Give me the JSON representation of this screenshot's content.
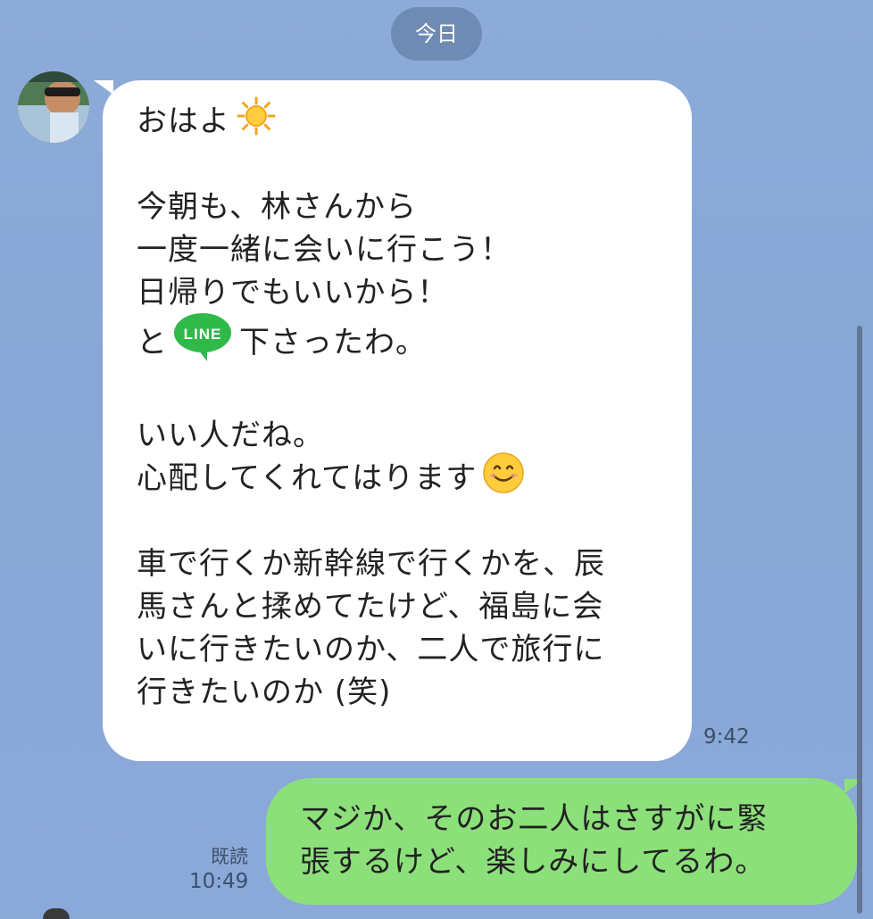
{
  "date_separator": "今日",
  "incoming": {
    "lines": {
      "l1": "おはよ",
      "l3": "今朝も、林さんから",
      "l4": "一度一緒に会いに行こう！",
      "l5": "日帰りでもいいから！",
      "l6a": "と",
      "l6b": "下さったわ。",
      "l8": "いい人だね。",
      "l9": "心配してくれてはります",
      "l11": "車で行くか新幹線で行くかを、辰",
      "l12": "馬さんと揉めてたけど、福島に会",
      "l13": "いに行きたいのか、二人で旅行に",
      "l14": "行きたいのか (笑)"
    },
    "emoji_icons": [
      "sun-icon",
      "line-icon",
      "smile-icon"
    ],
    "line_badge_text": "LINE",
    "time": "9:42"
  },
  "outgoing": {
    "lines": {
      "l1": "マジか、そのお二人はさすがに緊",
      "l2": "張するけど、楽しみにしてるわ。"
    },
    "read_label": "既読",
    "time": "10:49"
  },
  "colors": {
    "background": "#8aaad8",
    "incoming_bubble": "#ffffff",
    "outgoing_bubble": "#8ce07a",
    "line_brand": "#2fb948"
  }
}
